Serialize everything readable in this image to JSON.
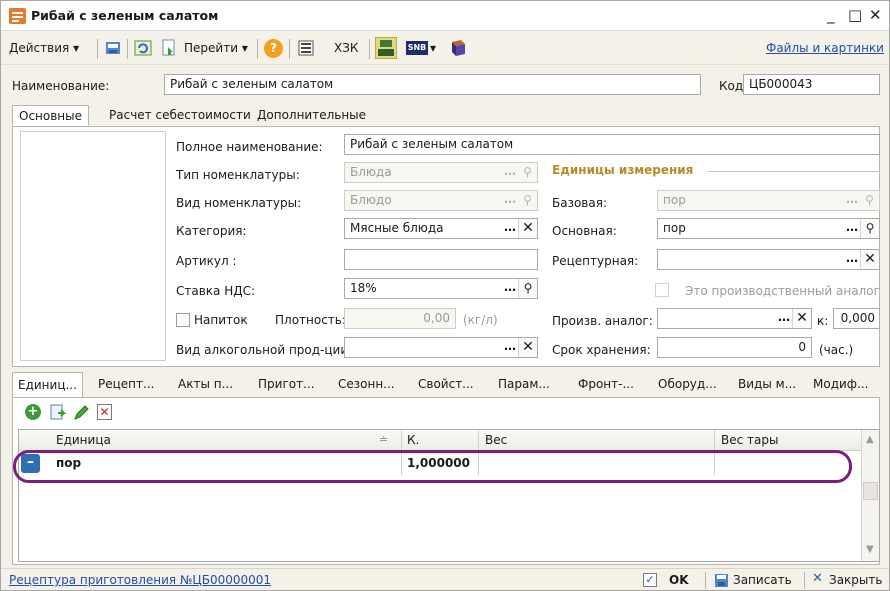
{
  "window": {
    "title": "Рибай с зеленым салатом",
    "controls": {
      "minimize": "_",
      "maximize": "□",
      "close": "✕"
    }
  },
  "toolbar": {
    "actions_label": "Действия",
    "goto_label": "Перейти",
    "help_label": "?",
    "xzk_label": "ХЗК",
    "snb_label": "SNB",
    "files_link": "Файлы и картинки"
  },
  "header": {
    "name_label": "Наименование:",
    "name_value": "Рибай с зеленым салатом",
    "code_label": "Код:",
    "code_value": "ЦБ000043"
  },
  "tabs": [
    {
      "label": "Основные",
      "active": true
    },
    {
      "label": "Расчет себестоимости",
      "active": false
    },
    {
      "label": "Дополнительные",
      "active": false
    }
  ],
  "main": {
    "full_name_label": "Полное наименование:",
    "full_name_value": "Рибай с зеленым салатом",
    "nom_type_label": "Тип номенклатуры:",
    "nom_type_value": "Блюда",
    "nom_kind_label": "Вид номенклатуры:",
    "nom_kind_value": "Блюдо",
    "category_label": "Категория:",
    "category_value": "Мясные блюда",
    "article_label": "Артикул :",
    "article_value": "",
    "vat_label": "Ставка НДС:",
    "vat_value": "18%",
    "drink_label": "Напиток",
    "density_label": "Плотность:",
    "density_value": "0,00",
    "density_unit": "(кг/л)",
    "alcohol_label": "Вид алкогольной прод-ции:",
    "alcohol_value": ""
  },
  "units": {
    "heading": "Единицы измерения",
    "base_label": "Базовая:",
    "base_value": "пор",
    "main_label": "Основная:",
    "main_value": "пор",
    "recipe_label": "Рецептурная:",
    "recipe_value": "",
    "production_analog_label": "Это производственный аналог",
    "prod_analog_label": "Произв. аналог:",
    "prod_analog_value": "",
    "k_label": "к:",
    "k_value": "0,000",
    "shelf_life_label": "Срок хранения:",
    "shelf_life_value": "0",
    "shelf_life_unit": "(час.)"
  },
  "bottom_tabs": [
    {
      "label": "Единиц...",
      "active": true
    },
    {
      "label": "Рецепт...",
      "active": false
    },
    {
      "label": "Акты п...",
      "active": false
    },
    {
      "label": "Пригот...",
      "active": false
    },
    {
      "label": "Сезонн...",
      "active": false
    },
    {
      "label": "Свойст...",
      "active": false
    },
    {
      "label": "Парам...",
      "active": false
    },
    {
      "label": "Фронт-...",
      "active": false
    },
    {
      "label": "Оборуд...",
      "active": false
    },
    {
      "label": "Виды м...",
      "active": false
    },
    {
      "label": "Модиф...",
      "active": false
    }
  ],
  "grid": {
    "columns": [
      "Единица",
      "К.",
      "Вес",
      "Вес тары"
    ],
    "rows": [
      {
        "unit": "пор",
        "k": "1,000000",
        "weight": "",
        "tare": ""
      }
    ]
  },
  "statusbar": {
    "recipe_link": "Рецептура приготовления №ЦБ00000001",
    "ok_label": "OK",
    "save_label": "Записать",
    "close_label": "Закрыть"
  },
  "colors": {
    "accent_heading": "#b88a2a",
    "link": "#1f4fa8",
    "highlight": "#7a1f7c"
  }
}
